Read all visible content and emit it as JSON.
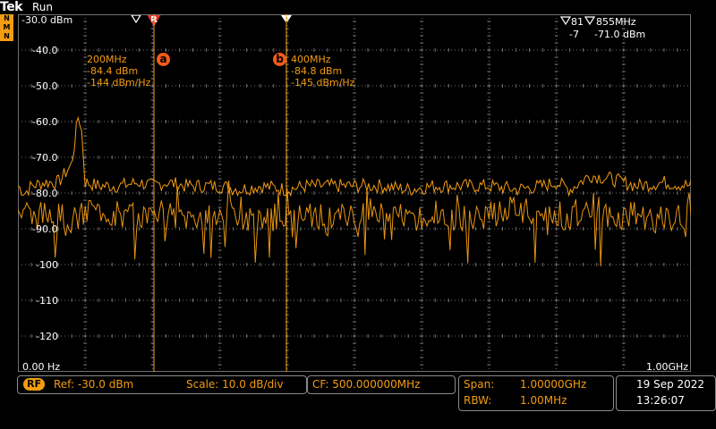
{
  "header": {
    "brand": "Tek",
    "status": "Run",
    "mode_letters": [
      "N",
      "M",
      "N"
    ]
  },
  "axes": {
    "y_labels": [
      "-30.0 dBm",
      "-40.0",
      "-50.0",
      "-60.0",
      "-70.0",
      "-80.0",
      "-90.0",
      "-100",
      "-110",
      "-120"
    ],
    "x_start": "0.00 Hz",
    "x_end": "1.00GHz"
  },
  "markers": {
    "ref_marker": "R",
    "a": {
      "badge": "a",
      "freq": "200MHz",
      "level": "-84.4 dBm",
      "density": "-144 dBm/Hz"
    },
    "b": {
      "badge": "b",
      "freq": "400MHz",
      "level": "-84.8 dBm",
      "density": "-145 dBm/Hz"
    }
  },
  "readout": {
    "line1a": "81",
    "line1b": "855MHz",
    "line2a": "-7",
    "line2b": "-71.0 dBm"
  },
  "bottom": {
    "rf_badge": "RF",
    "ref": "Ref: -30.0 dBm",
    "scale": "Scale: 10.0 dB/div",
    "cf": "CF:  500.000000MHz",
    "span_label": "Span:",
    "span_value": "1.00000GHz",
    "rbw_label": "RBW:",
    "rbw_value": "1.00MHz",
    "date": "19 Sep  2022",
    "time": "13:26:07"
  },
  "colors": {
    "trace_accent": "#f39c12",
    "marker_badge": "#f35b1b",
    "grid": "#707070"
  },
  "chart_data": {
    "type": "line",
    "title": "",
    "xlabel": "",
    "ylabel": "",
    "x_unit": "MHz",
    "y_unit": "dBm",
    "xlim": [
      0,
      1000
    ],
    "ylim": [
      -130,
      -30
    ],
    "series": [
      {
        "x": [
          0,
          10,
          20,
          40,
          60,
          80,
          90,
          95,
          100,
          120,
          150,
          180,
          200,
          220,
          250,
          280,
          300,
          330,
          360,
          400,
          430,
          460,
          500,
          540,
          580,
          620,
          660,
          700,
          740,
          780,
          800,
          820,
          850,
          880,
          920,
          960,
          1000
        ],
        "y": [
          -78,
          -80,
          -78,
          -77,
          -77,
          -72,
          -58,
          -63,
          -77,
          -78,
          -78,
          -77,
          -78,
          -77,
          -78,
          -78,
          -78,
          -79,
          -78,
          -79,
          -78,
          -78,
          -78,
          -78,
          -79,
          -78,
          -78,
          -78,
          -79,
          -78,
          -77,
          -79,
          -75,
          -76,
          -78,
          -77,
          -78
        ]
      },
      {
        "x": [
          0,
          10,
          20,
          40,
          60,
          80,
          100,
          120,
          150,
          180,
          200,
          220,
          250,
          280,
          300,
          330,
          360,
          400,
          430,
          460,
          500,
          540,
          580,
          620,
          660,
          700,
          740,
          780,
          800,
          820,
          850,
          880,
          920,
          960,
          1000
        ],
        "y": [
          -86,
          -84,
          -87,
          -86,
          -84,
          -88,
          -86,
          -85,
          -86,
          -87,
          -85,
          -86,
          -87,
          -86,
          -85,
          -86,
          -88,
          -85,
          -86,
          -87,
          -86,
          -85,
          -87,
          -86,
          -87,
          -86,
          -85,
          -86,
          -86,
          -87,
          -83,
          -87,
          -86,
          -88,
          -86
        ]
      }
    ],
    "grid": true
  }
}
